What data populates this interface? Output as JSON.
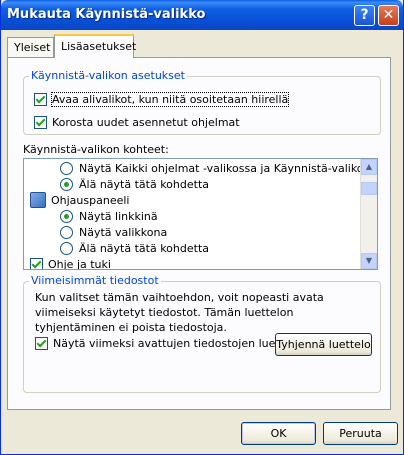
{
  "window": {
    "title": "Mukauta Käynnistä-valikko"
  },
  "titlebar_buttons": {
    "help": "?",
    "close": "✕"
  },
  "tabs": [
    {
      "label": "Yleiset",
      "active": false
    },
    {
      "label": "Lisäasetukset",
      "active": true
    }
  ],
  "start_settings": {
    "title": "Käynnistä-valikon asetukset",
    "options": [
      {
        "label": "Avaa alivalikot, kun niitä osoitetaan hiirellä",
        "checked": true
      },
      {
        "label": "Korosta uudet asennetut ohjelmat",
        "checked": true
      }
    ]
  },
  "items_section": {
    "label": "Käynnistä-valikon kohteet:",
    "list": [
      {
        "kind": "radio",
        "label": "Näytä Kaikki ohjelmat -valikossa ja Käynnistä-valikossa",
        "selected": false
      },
      {
        "kind": "radio",
        "label": "Älä näytä tätä kohdetta",
        "selected": true
      },
      {
        "kind": "header",
        "label": "Ohjauspaneeli",
        "icon": "control-panel-icon"
      },
      {
        "kind": "radio",
        "label": "Näytä linkkinä",
        "selected": true
      },
      {
        "kind": "radio",
        "label": "Näytä valikkona",
        "selected": false
      },
      {
        "kind": "radio",
        "label": "Älä näytä tätä kohdetta",
        "selected": false
      },
      {
        "kind": "checkbox",
        "label": "Ohje ja tuki",
        "checked": true
      }
    ]
  },
  "recent_docs": {
    "title": "Viimeisimmät tiedostot",
    "description": "Kun valitset tämän vaihtoehdon, voit nopeasti avata viimeiseksi käytetyt tiedostot. Tämän luettelon tyhjentäminen ei poista tiedostoja.",
    "show_label": "Näytä viimeksi avattujen tiedostojen luettelo",
    "show_checked": true,
    "clear_button": "Tyhjennä luettelo"
  },
  "footer": {
    "ok": "OK",
    "cancel": "Peruuta"
  }
}
